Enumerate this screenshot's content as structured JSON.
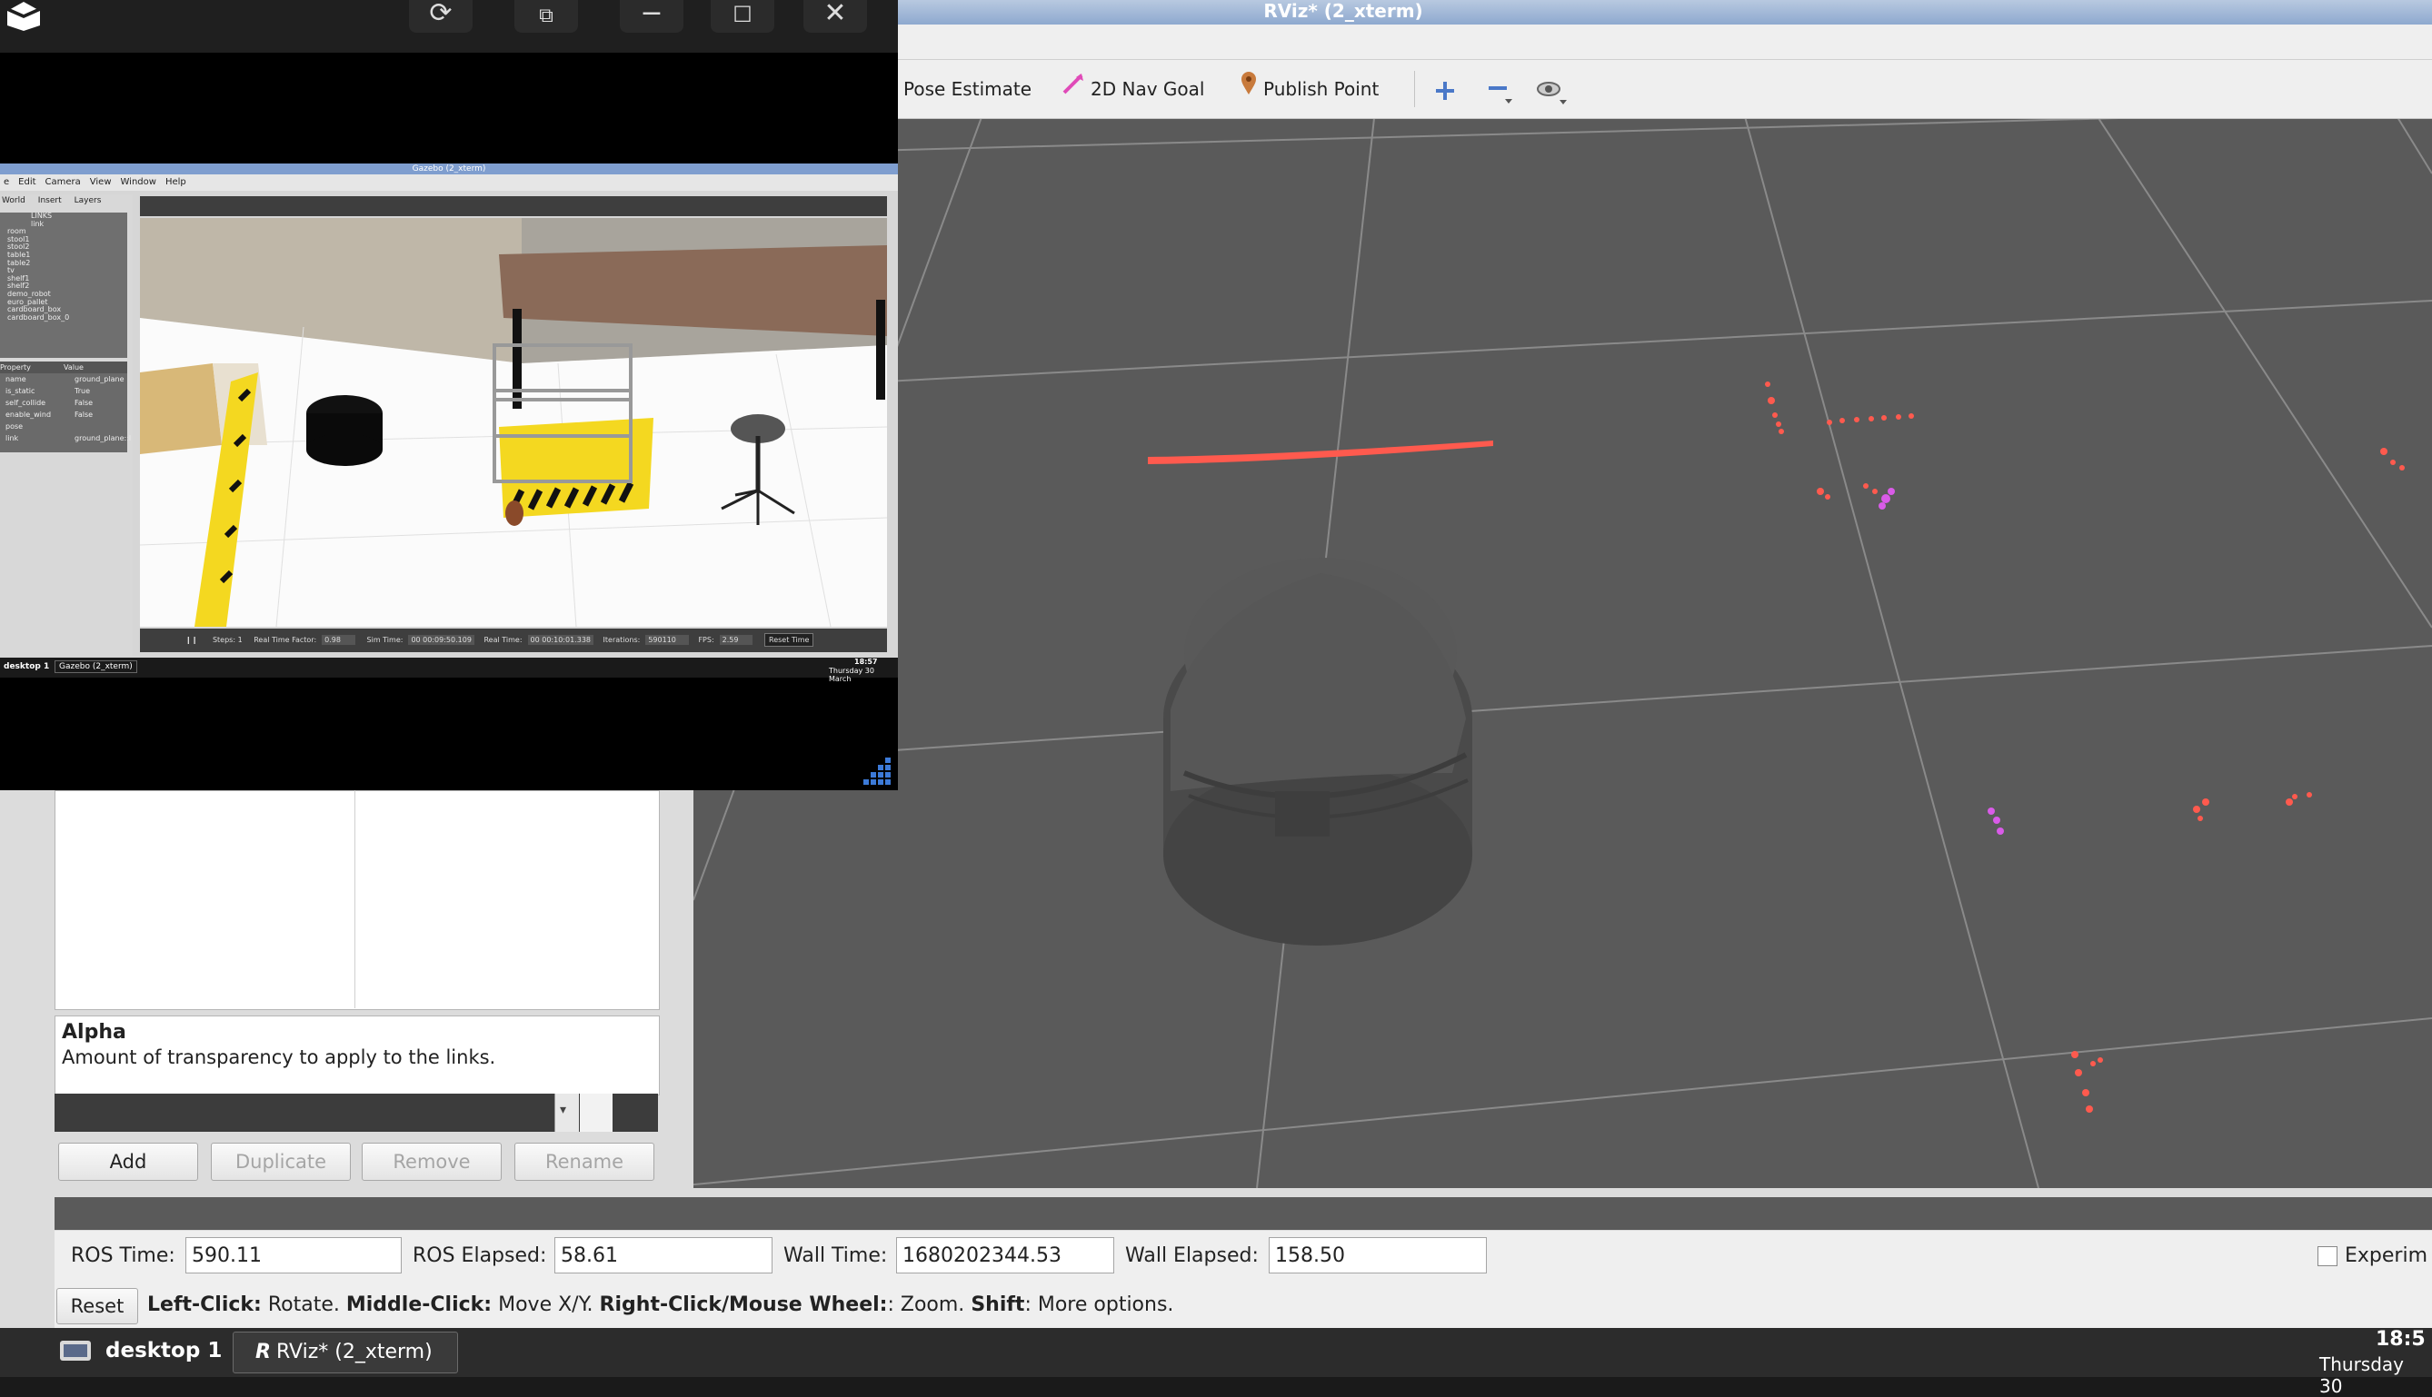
{
  "rviz": {
    "window_title": "RViz* (2_xterm)",
    "toolbar": {
      "pose_estimate": "Pose Estimate",
      "nav_goal": "2D Nav Goal",
      "publish_point": "Publish Point"
    },
    "property_help": {
      "title": "Alpha",
      "text": "Amount of transparency to apply to the links."
    },
    "buttons": {
      "add": "Add",
      "duplicate": "Duplicate",
      "remove": "Remove",
      "rename": "Rename"
    },
    "time": {
      "ros_time_label": "ROS Time:",
      "ros_time": "590.11",
      "ros_elapsed_label": "ROS Elapsed:",
      "ros_elapsed": "58.61",
      "wall_time_label": "Wall Time:",
      "wall_time": "1680202344.53",
      "wall_elapsed_label": "Wall Elapsed:",
      "wall_elapsed": "158.50",
      "experimental": "Experim"
    },
    "reset": "Reset",
    "hint": {
      "left": "Left-Click:",
      "left_t": " Rotate. ",
      "middle": "Middle-Click:",
      "middle_t": " Move X/Y. ",
      "right": "Right-Click/Mouse Wheel:",
      "right_t": ": Zoom. ",
      "shift": "Shift",
      "shift_t": ": More options."
    }
  },
  "taskbar": {
    "desktop": "desktop 1",
    "window": "RViz* (2_xterm)",
    "time": "18:5",
    "date": "Thursday 30"
  },
  "gazebo": {
    "title": "Gazebo (2_xterm)",
    "menu": [
      "e",
      "Edit",
      "Camera",
      "View",
      "Window",
      "Help"
    ],
    "tabs": [
      "World",
      "Insert",
      "Layers"
    ],
    "tree": [
      "LINKS",
      "link",
      "room",
      "stool1",
      "stool2",
      "table1",
      "table2",
      "tv",
      "shelf1",
      "shelf2",
      "demo_robot",
      "euro_pallet",
      "cardboard_box",
      "cardboard_box_0"
    ],
    "props_header": [
      "Property",
      "Value"
    ],
    "props": [
      [
        "name",
        "ground_plane"
      ],
      [
        "is_static",
        "True"
      ],
      [
        "self_collide",
        "False"
      ],
      [
        "enable_wind",
        "False"
      ],
      [
        "pose",
        ""
      ],
      [
        "link",
        "ground_plane::l"
      ]
    ],
    "status": {
      "steps": "Steps: 1",
      "rtf_label": "Real Time Factor:",
      "rtf": "0.98",
      "sim_label": "Sim Time:",
      "sim": "00 00:09:50.109",
      "real_label": "Real Time:",
      "real": "00 00:10:01.338",
      "iter_label": "Iterations:",
      "iter": "590110",
      "fps_label": "FPS:",
      "fps": "2.59",
      "reset": "Reset Time"
    },
    "taskbar_desktop": "desktop 1",
    "taskbar_window": "Gazebo (2_xterm)",
    "clock": "18:57",
    "date": "Thursday 30 March"
  },
  "colors": {
    "laser": "#ff5a4e",
    "laser_alt": "#d95be8",
    "viewport_bg": "#5a5a5a"
  }
}
